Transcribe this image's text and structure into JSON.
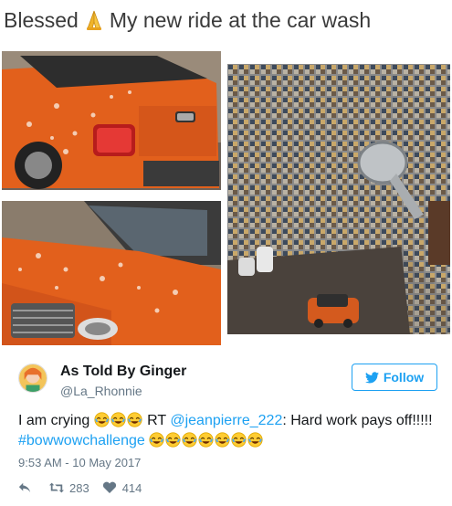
{
  "caption": {
    "before": "Blessed",
    "after": "My new ride at the car wash",
    "pray_icon": "folded-hands-emoji"
  },
  "photos": [
    {
      "id": "range-rover-rear",
      "description": ""
    },
    {
      "id": "range-rover-front",
      "description": ""
    },
    {
      "id": "toy-car-in-shower",
      "description": ""
    }
  ],
  "tweet": {
    "author_name": "As Told By Ginger",
    "author_handle": "@La_Rhonnie",
    "follow_label": "Follow",
    "text_intro": "I am crying",
    "rt_label": "RT",
    "mention": "@jeanpierre_222",
    "text_body": ": Hard work pays off!!!!!",
    "hashtag": "#bowwowchallenge",
    "timestamp": "9:53 AM - 10 May 2017",
    "retweets": "283",
    "likes": "414",
    "accent_color": "#1da1f2",
    "laugh_emoji": "face-with-tears-of-joy"
  }
}
